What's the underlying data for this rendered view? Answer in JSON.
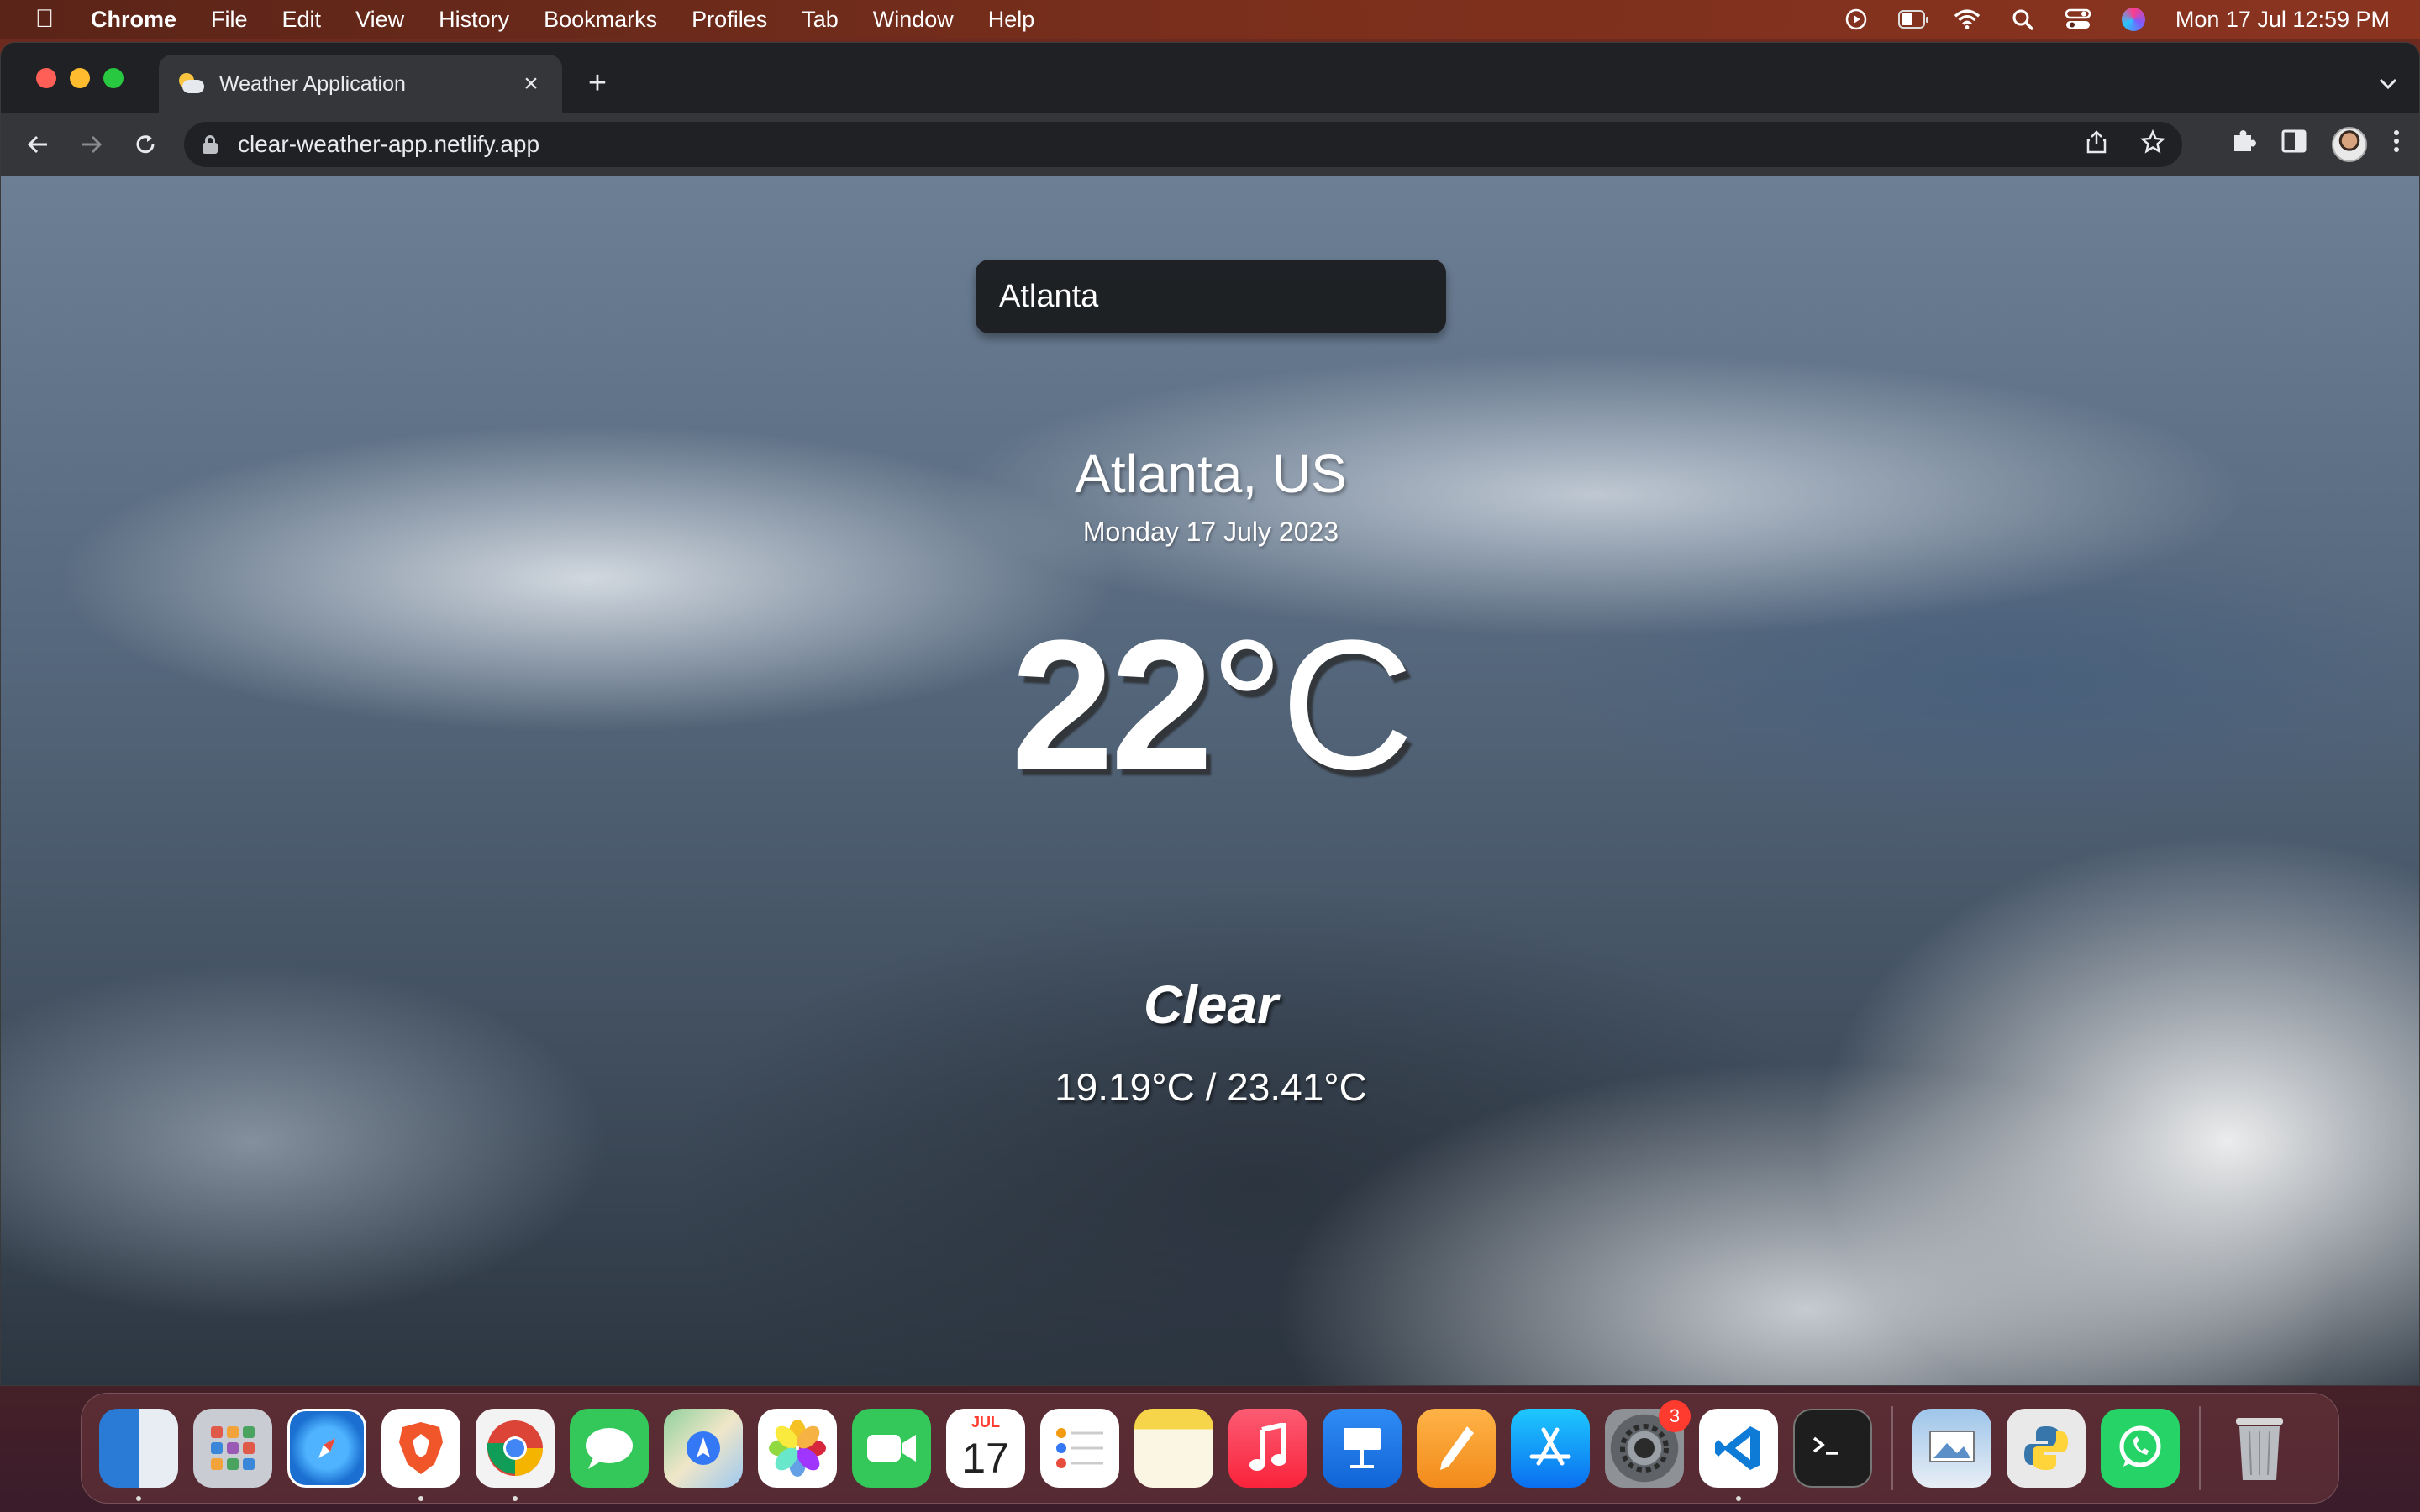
{
  "menubar": {
    "app_name": "Chrome",
    "items": [
      "File",
      "Edit",
      "View",
      "History",
      "Bookmarks",
      "Profiles",
      "Tab",
      "Window",
      "Help"
    ],
    "clock": "Mon 17 Jul  12:59 PM",
    "battery_level": 0.35
  },
  "browser": {
    "tab_title": "Weather Application",
    "url": "clear-weather-app.netlify.app"
  },
  "weather": {
    "search_value": "Atlanta",
    "location": "Atlanta, US",
    "date": "Monday 17 July 2023",
    "temp_value": "22",
    "temp_unit": "°C",
    "condition": "Clear",
    "range": "19.19°C / 23.41°C"
  },
  "dock": {
    "calendar_month": "JUL",
    "calendar_day": "17",
    "settings_badge": "3",
    "apps": [
      "Finder",
      "Launchpad",
      "Safari",
      "Brave",
      "Chrome",
      "Messages",
      "Maps",
      "Photos",
      "FaceTime",
      "Calendar",
      "Reminders",
      "Notes",
      "Music",
      "Keynote",
      "Pages",
      "App Store",
      "System Settings",
      "VS Code",
      "Terminal",
      "Preview",
      "Python",
      "WhatsApp",
      "Trash"
    ]
  }
}
